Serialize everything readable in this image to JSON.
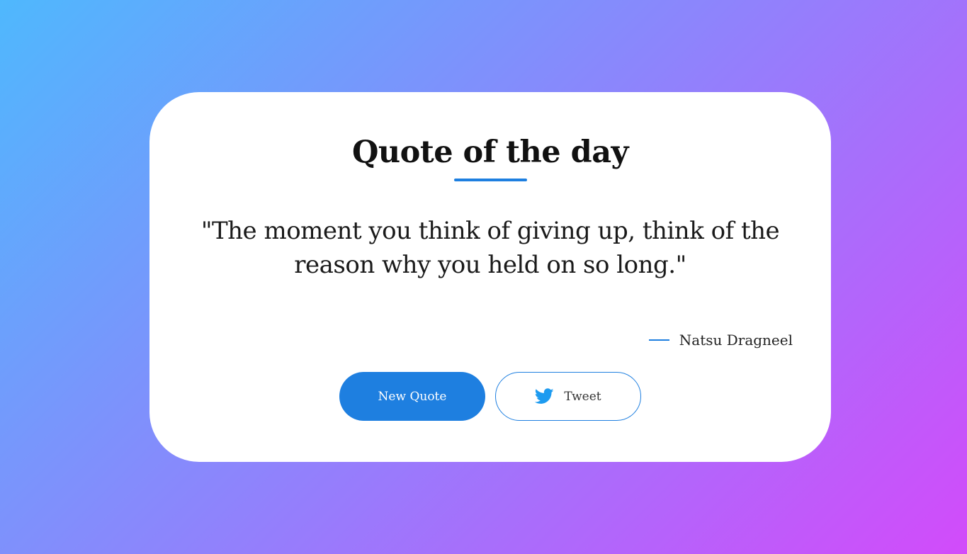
{
  "card": {
    "title": "Quote of the day",
    "quote": "\"The moment you think of giving up, think of the reason why you held on so long.\"",
    "author": "Natsu Dragneel"
  },
  "actions": {
    "new_quote_label": "New Quote",
    "tweet_label": "Tweet",
    "tweet_icon": "twitter-bird-icon"
  },
  "colors": {
    "accent": "#1e7fe0",
    "background_gradient_start": "#4fb8fd",
    "background_gradient_end": "#d24bfa",
    "twitter_blue": "#1d9bf0"
  }
}
